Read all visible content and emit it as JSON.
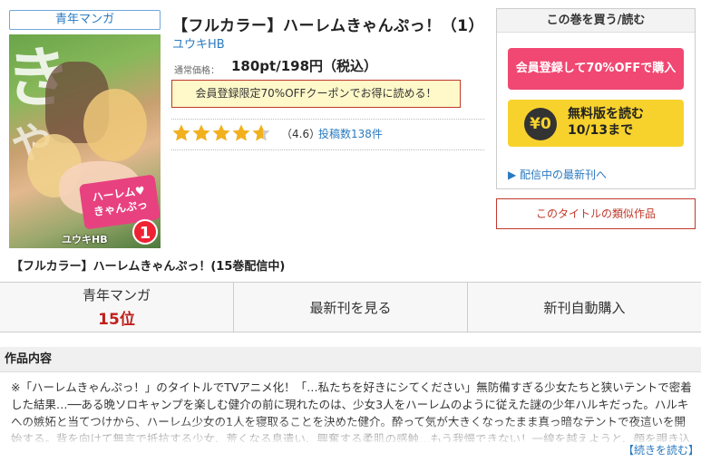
{
  "genre_tag": "青年マンガ",
  "cover": {
    "title_line1": "ハーレム♥",
    "title_line2": "きゃんぷっ",
    "volume": "1",
    "author": "ユウキHB",
    "big_text_1": "き",
    "big_text_2": "や"
  },
  "book": {
    "title": "【フルカラー】ハーレムきゃんぷっ！（1）",
    "author": "ユウキHB",
    "price_label": "通常価格：",
    "price_value": "180pt/198円（税込）",
    "coupon_text": "会員登録限定70%OFFクーポンでお得に読める！",
    "rating_value": 4.6,
    "rating_text": "（4.6）",
    "reviews_text": "投稿数138件"
  },
  "buy_panel": {
    "title": "この巻を買う/読む",
    "buy_button": "会員登録して70%OFFで購入",
    "free_yen": "¥0",
    "free_line1": "無料版を読む",
    "free_line2": "10/13まで",
    "latest_link": "▶ 配信中の最新刊へ"
  },
  "similar_button": "このタイトルの類似作品",
  "series_label": "【フルカラー】ハーレムきゃんぷっ！(15巻配信中)",
  "rank_bar": {
    "genre": "青年マンガ",
    "rank": "15位",
    "latest": "最新刊を見る",
    "auto": "新刊自動購入"
  },
  "description": {
    "header": "作品内容",
    "text": "※「ハーレムきゃんぷっ！」のタイトルでTVアニメ化！「…私たちを好きにシてください」無防備すぎる少女たちと狭いテントで密着した結果…──ある晩ソロキャンプを楽しむ健介の前に現れたのは、少女3人をハーレムのように従えた謎の少年ハルキだった。ハルキへの嫉妬と当てつけから、ハーレム少女の1人を寝取ることを決めた健介。酔って気が大きくなったまま真っ暗なテントで夜這いを開始する。背を向けて無言で抵抗する少女、荒くなる息遣い、興奮する柔肌の感触…もう我慢できない！一線を越えようと、顔を覗き込んだ健介が見たもの",
    "more_link": "【続きを読む】"
  },
  "colors": {
    "accent_blue": "#2a7ac0",
    "buy_pink": "#f04872",
    "free_yellow": "#f7d22d",
    "rank_red": "#c0201c",
    "star_gold": "#f2b01e"
  }
}
